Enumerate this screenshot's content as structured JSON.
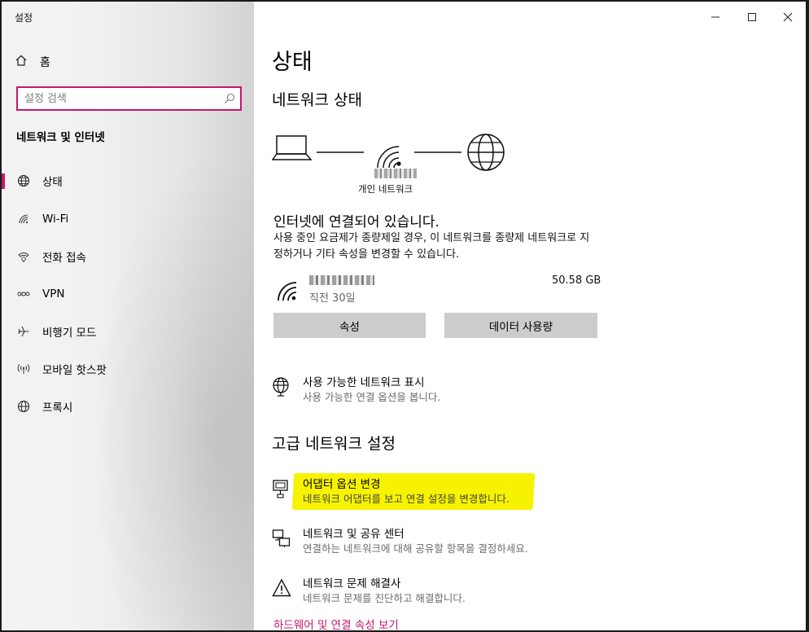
{
  "window": {
    "app_title": "설정"
  },
  "sidebar": {
    "home_label": "홈",
    "search_placeholder": "설정 검색",
    "section_title": "네트워크 및 인터넷",
    "items": [
      {
        "label": "상태",
        "icon": "globe-icon",
        "active": true
      },
      {
        "label": "Wi-Fi",
        "icon": "wifi-icon",
        "active": false
      },
      {
        "label": "전화 접속",
        "icon": "dial-up-icon",
        "active": false
      },
      {
        "label": "VPN",
        "icon": "vpn-icon",
        "active": false
      },
      {
        "label": "비행기 모드",
        "icon": "airplane-icon",
        "active": false
      },
      {
        "label": "모바일 핫스팟",
        "icon": "hotspot-icon",
        "active": false
      },
      {
        "label": "프록시",
        "icon": "globe-icon",
        "active": false
      }
    ]
  },
  "main": {
    "page_title": "상태",
    "network_status_heading": "네트워크 상태",
    "network_profile": "개인 네트워크",
    "connection_title": "인터넷에 연결되어 있습니다.",
    "connection_desc": "사용 중인 요금제가 종량제일 경우, 이 네트워크를 종량제 네트워크로 지정하거나 기타 속성을 변경할 수 있습니다.",
    "usage_period": "직전 30일",
    "usage_amount": "50.58 GB",
    "properties_button": "속성",
    "data_usage_button": "데이터 사용량",
    "show_networks_title": "사용 가능한 네트워크 표시",
    "show_networks_desc": "사용 가능한 연결 옵션을 봅니다.",
    "advanced_heading": "고급 네트워크 설정",
    "adapter_title": "어댑터 옵션 변경",
    "adapter_desc": "네트워크 어댑터를 보고 연결 설정을 변경합니다.",
    "sharing_title": "네트워크 및 공유 센터",
    "sharing_desc": "연결하는 네트워크에 대해 공유할 항목을 결정하세요.",
    "troubleshoot_title": "네트워크 문제 해결사",
    "troubleshoot_desc": "네트워크 문제를 진단하고 해결합니다.",
    "hardware_link": "하드웨어 및 연결 속성 보기"
  },
  "colors": {
    "accent": "#c3186b",
    "highlight": "#f7f300",
    "button": "#cccccc"
  }
}
